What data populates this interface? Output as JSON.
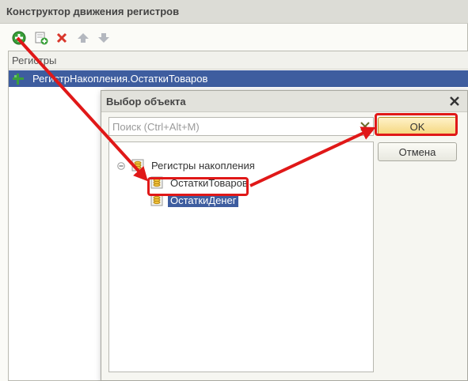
{
  "window": {
    "title": "Конструктор движения регистров"
  },
  "toolbar": {
    "buttons": [
      {
        "icon": "add-icon"
      },
      {
        "icon": "add-copy-icon"
      },
      {
        "icon": "delete-icon"
      },
      {
        "icon": "move-up-icon"
      },
      {
        "icon": "move-down-icon"
      }
    ]
  },
  "registers": {
    "header": "Регистры",
    "rows": [
      {
        "label": "РегистрНакопления.ОстаткиТоваров",
        "icon": "register-icon"
      }
    ]
  },
  "dialog": {
    "title": "Выбор объекта",
    "search": {
      "placeholder": "Поиск (Ctrl+Alt+M)",
      "value": ""
    },
    "tree": {
      "root": {
        "label": "Регистры накопления",
        "expanded": true
      },
      "children": [
        {
          "label": "ОстаткиТоваров",
          "selected": false
        },
        {
          "label": "ОстаткиДенег",
          "selected": true
        }
      ]
    },
    "ok_label": "OK",
    "cancel_label": "Отмена"
  },
  "colors": {
    "selection": "#3e5d9f",
    "annotation": "#e01818",
    "ok_button": "#f4d57a"
  }
}
